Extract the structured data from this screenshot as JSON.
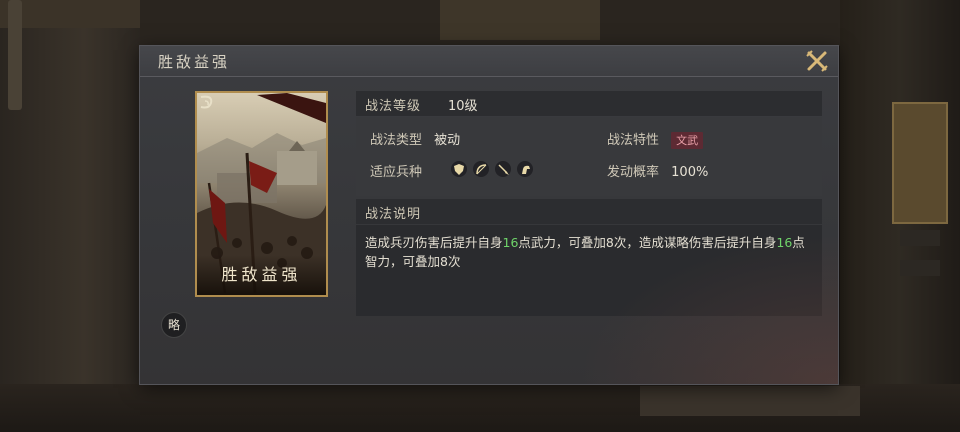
{
  "dialog": {
    "title": "胜敌益强"
  },
  "card": {
    "name": "胜敌益强"
  },
  "category_badge": "略",
  "level": {
    "label": "战法等级",
    "value": "10级"
  },
  "attributes": {
    "type_label": "战法类型",
    "type_value": "被动",
    "trait_label": "战法特性",
    "trait_value": "文武",
    "troops_label": "适应兵种",
    "troop_icons": [
      "shield-icon",
      "bow-icon",
      "spear-icon",
      "horse-icon"
    ],
    "chance_label": "发动概率",
    "chance_value": "100%"
  },
  "description": {
    "header": "战法说明",
    "part1": "造成兵刃伤害后提升自身",
    "num1": "16",
    "part2": "点武力，可叠加8次，造成谋略伤害后提升自身",
    "num2": "16",
    "part3": "点智力，可叠加8次"
  },
  "colors": {
    "number_highlight": "#6fd46a",
    "trait_tag_bg": "#5d2a33",
    "card_border": "#b08d4e"
  }
}
